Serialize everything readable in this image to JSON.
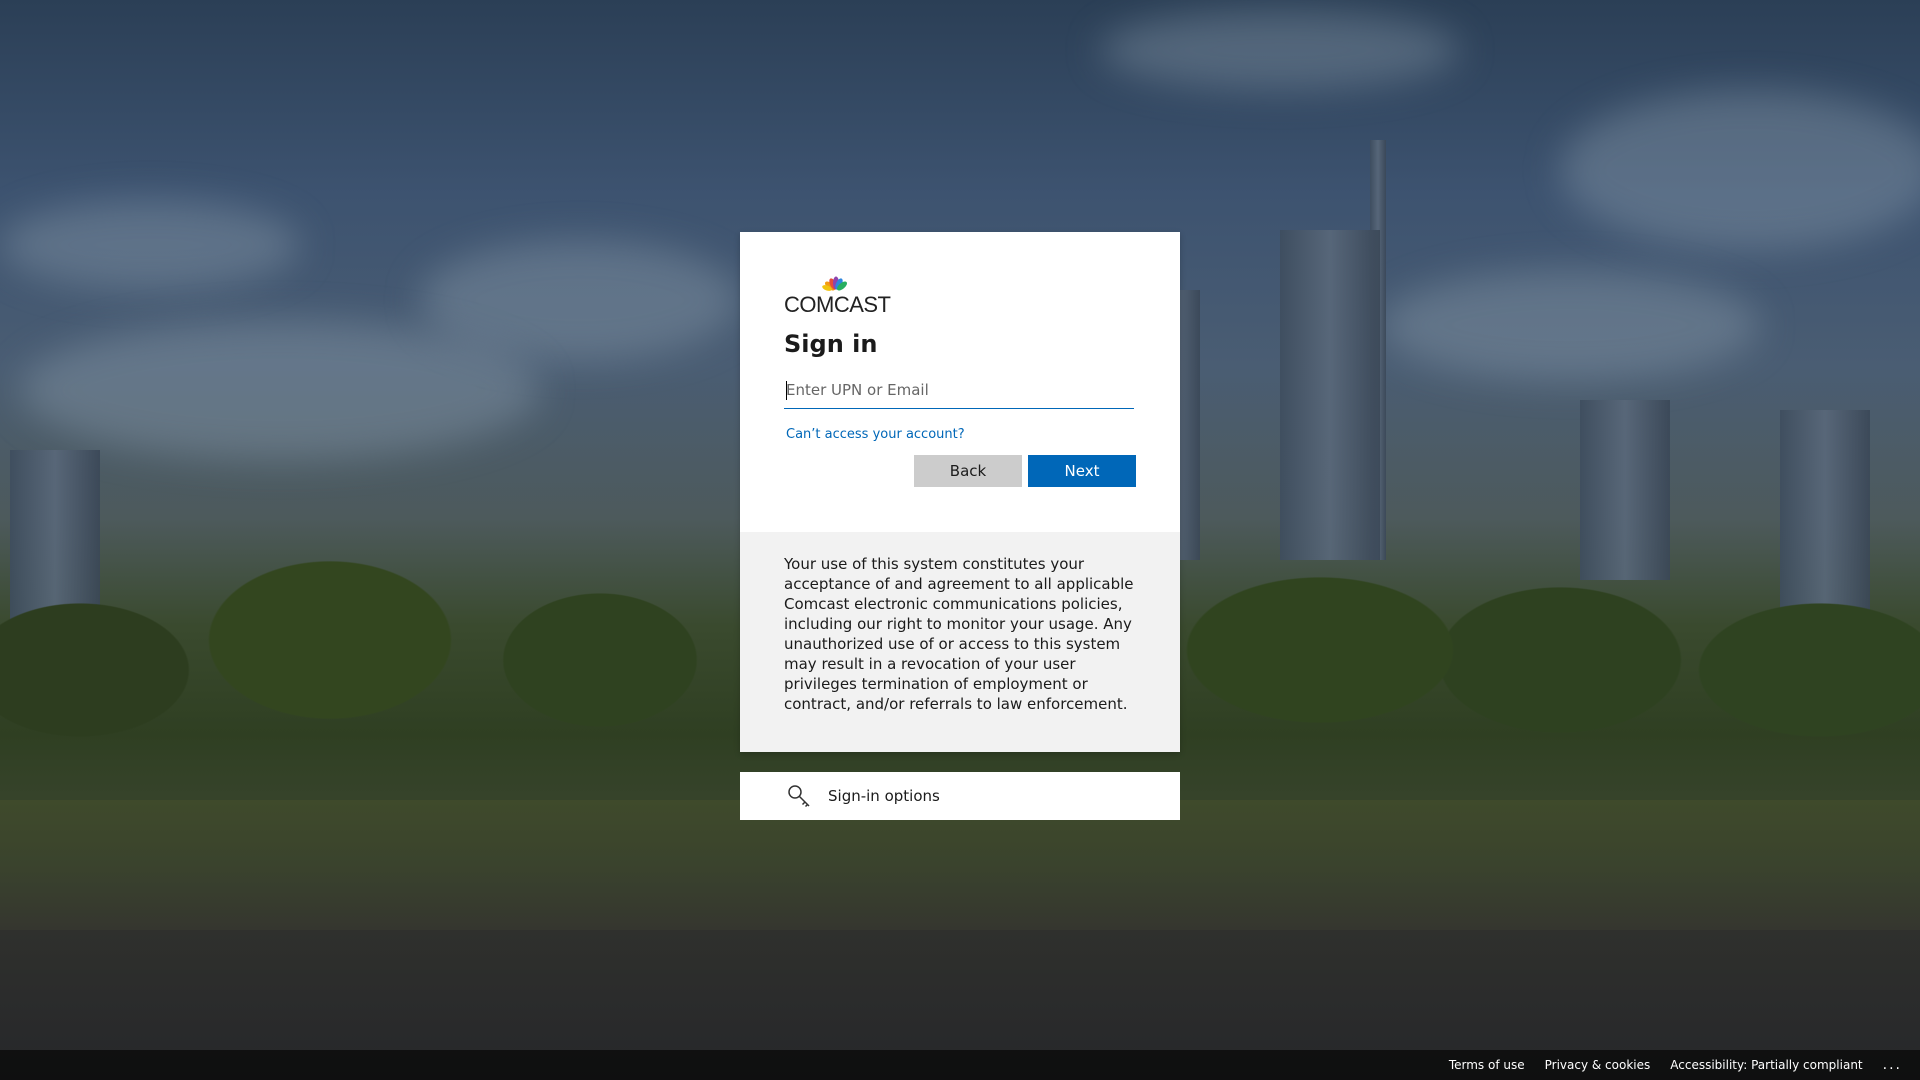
{
  "brand": {
    "logo_text": "COMCAST",
    "accent": "#0067b8"
  },
  "signin": {
    "title": "Sign in",
    "input_placeholder": "Enter UPN or Email",
    "input_value": "",
    "cant_access_link": "Can’t access your account?",
    "back_label": "Back",
    "next_label": "Next"
  },
  "notice": {
    "text": "Your use of this system constitutes your acceptance of and agreement to all applicable Comcast electronic communications policies, including our right to monitor your usage. Any unauthorized use of or access to this system may result in a revocation of your user privileges termination of employment or contract, and/or referrals to law enforcement."
  },
  "options": {
    "label": "Sign-in options",
    "icon": "key-search-icon"
  },
  "footer": {
    "terms": "Terms of use",
    "privacy": "Privacy & cookies",
    "accessibility": "Accessibility: Partially compliant",
    "more": "..."
  }
}
